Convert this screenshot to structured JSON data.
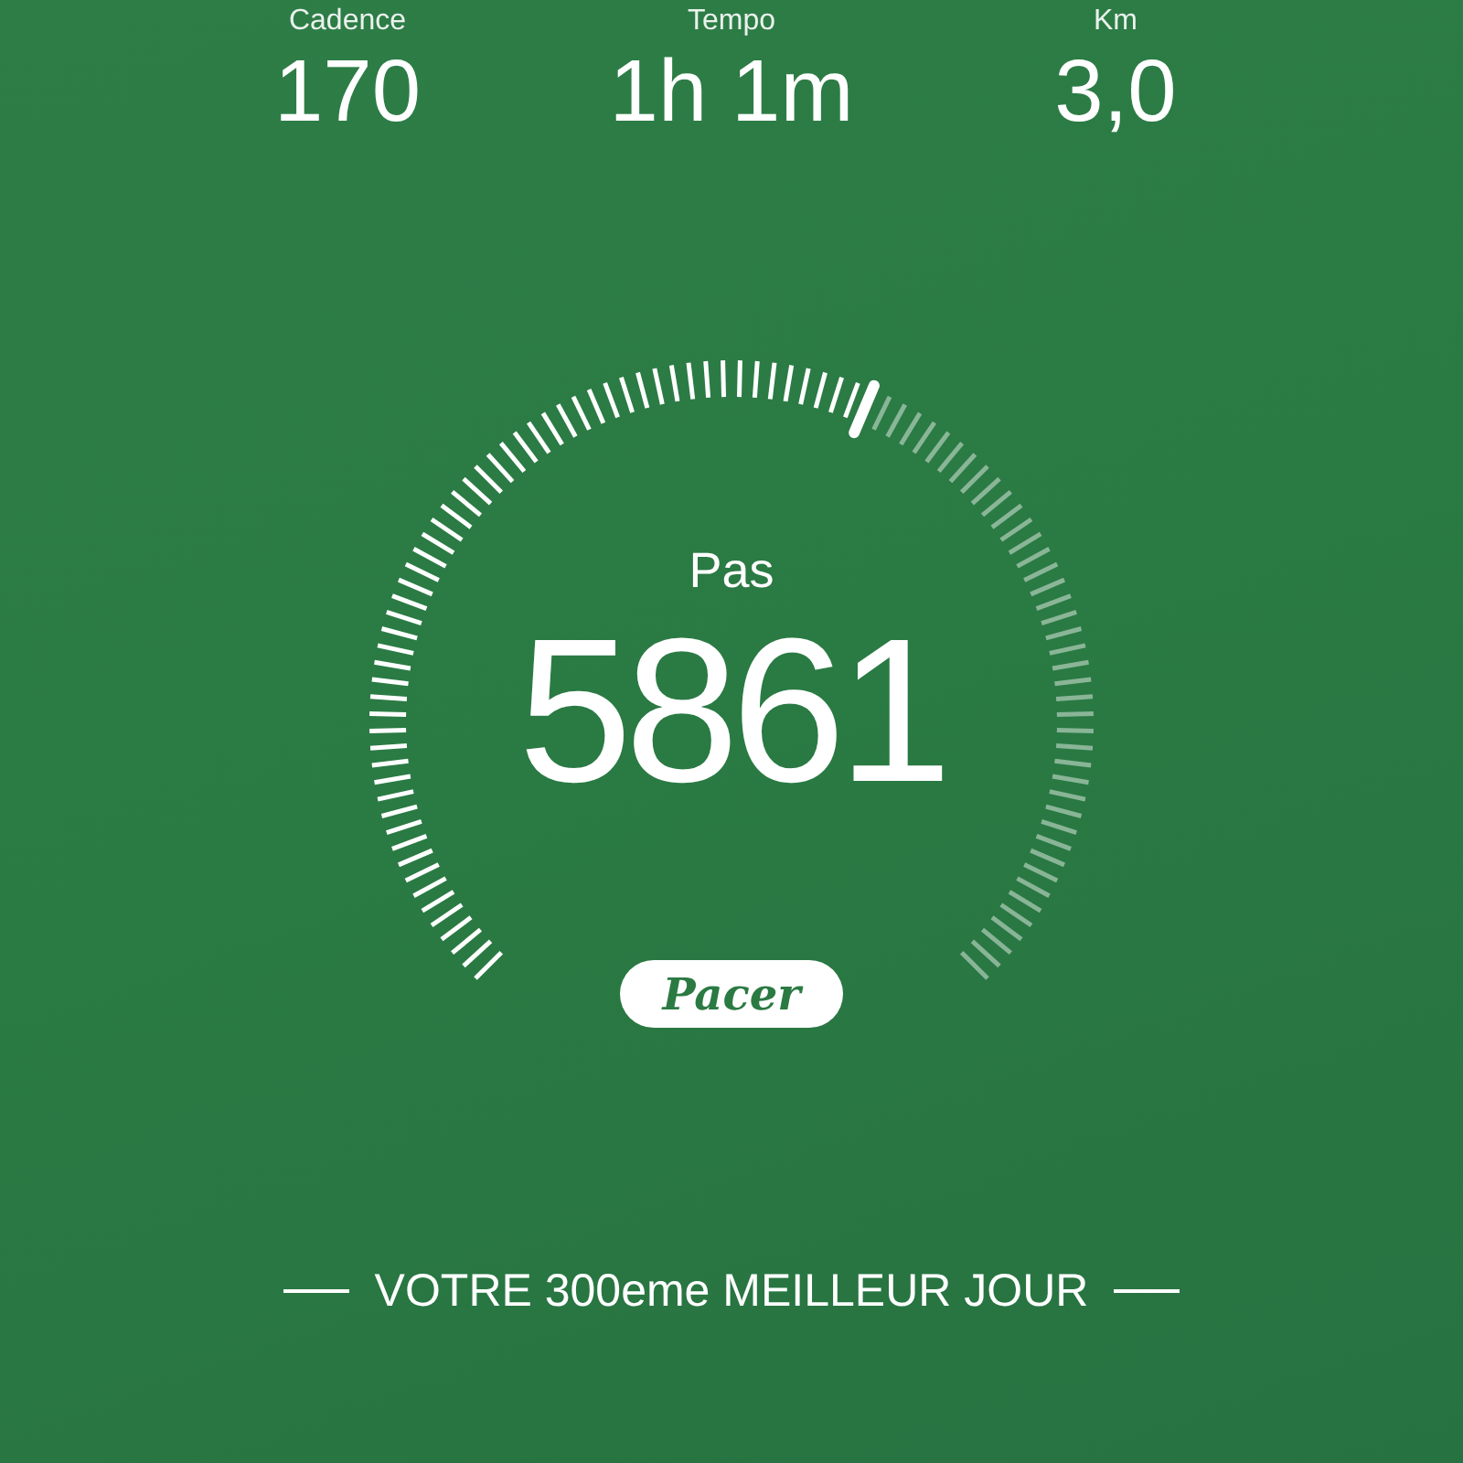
{
  "stats": [
    {
      "label": "Cadence",
      "value": "170"
    },
    {
      "label": "Tempo",
      "value": "1h 1m"
    },
    {
      "label": "Km",
      "value": "3,0"
    }
  ],
  "gauge": {
    "label": "Pas",
    "value": "5861"
  },
  "logo": "Pacer",
  "banner": "VOTRE 300eme MEILLEUR JOUR"
}
